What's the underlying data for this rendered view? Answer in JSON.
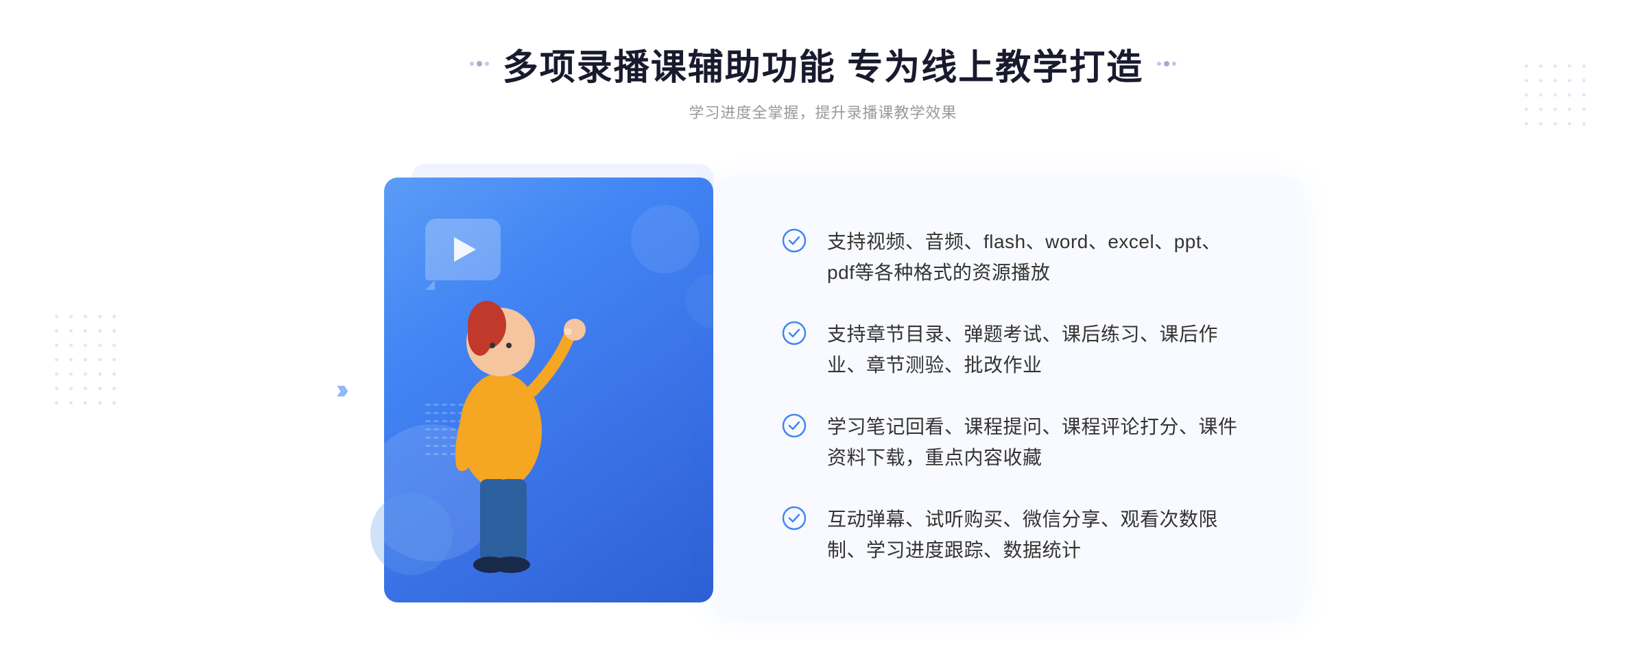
{
  "header": {
    "title": "多项录播课辅助功能 专为线上教学打造",
    "subtitle": "学习进度全掌握，提升录播课教学效果"
  },
  "features": [
    {
      "id": 1,
      "text": "支持视频、音频、flash、word、excel、ppt、pdf等各种格式的资源播放"
    },
    {
      "id": 2,
      "text": "支持章节目录、弹题考试、课后练习、课后作业、章节测验、批改作业"
    },
    {
      "id": 3,
      "text": "学习笔记回看、课程提问、课程评论打分、课件资料下载，重点内容收藏"
    },
    {
      "id": 4,
      "text": "互动弹幕、试听购买、微信分享、观看次数限制、学习进度跟踪、数据统计"
    }
  ],
  "colors": {
    "accent": "#4285f4",
    "title": "#1a1a2e",
    "text": "#333333",
    "subtle": "#999999",
    "bg": "#f8faff",
    "check": "#4285f4"
  }
}
